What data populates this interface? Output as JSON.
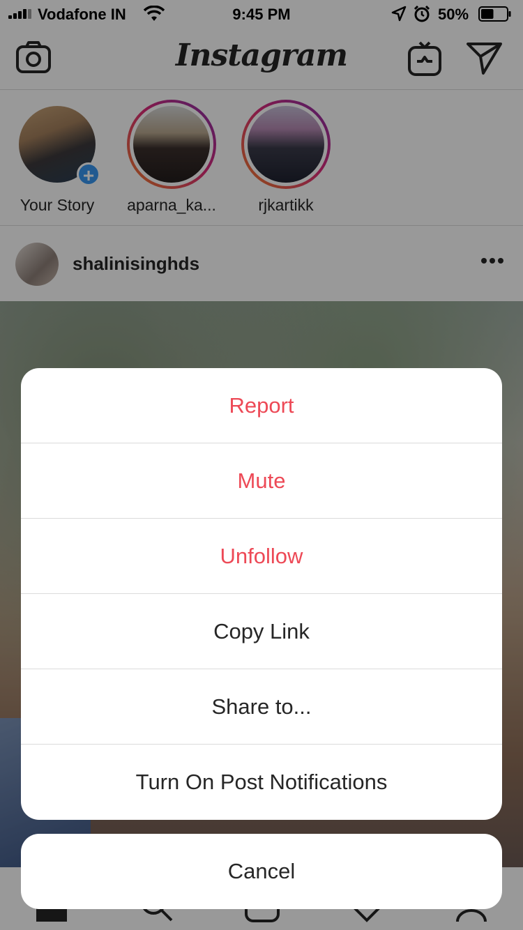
{
  "status_bar": {
    "carrier": "Vodafone IN",
    "time": "9:45 PM",
    "battery_percent": "50%",
    "battery_level": 0.5,
    "icons": [
      "signal-icon",
      "wifi-icon",
      "location-icon",
      "alarm-icon",
      "battery-icon"
    ]
  },
  "header": {
    "logo": "Instagram",
    "icons": [
      "camera-icon",
      "igtv-icon",
      "direct-message-icon"
    ]
  },
  "stories": [
    {
      "name": "Your Story",
      "own": true
    },
    {
      "name": "aparna_ka...",
      "own": false
    },
    {
      "name": "rjkartikk",
      "own": false
    }
  ],
  "post": {
    "username": "shalinisinghds",
    "more_icon": "more-options-icon"
  },
  "action_sheet": {
    "items": [
      {
        "label": "Report",
        "style": "destructive"
      },
      {
        "label": "Mute",
        "style": "destructive"
      },
      {
        "label": "Unfollow",
        "style": "destructive"
      },
      {
        "label": "Copy Link",
        "style": "default"
      },
      {
        "label": "Share to...",
        "style": "default"
      },
      {
        "label": "Turn On Post Notifications",
        "style": "default"
      }
    ],
    "cancel_label": "Cancel"
  },
  "colors": {
    "destructive": "#ed4956",
    "text": "#262626",
    "accent": "#3897f0"
  }
}
